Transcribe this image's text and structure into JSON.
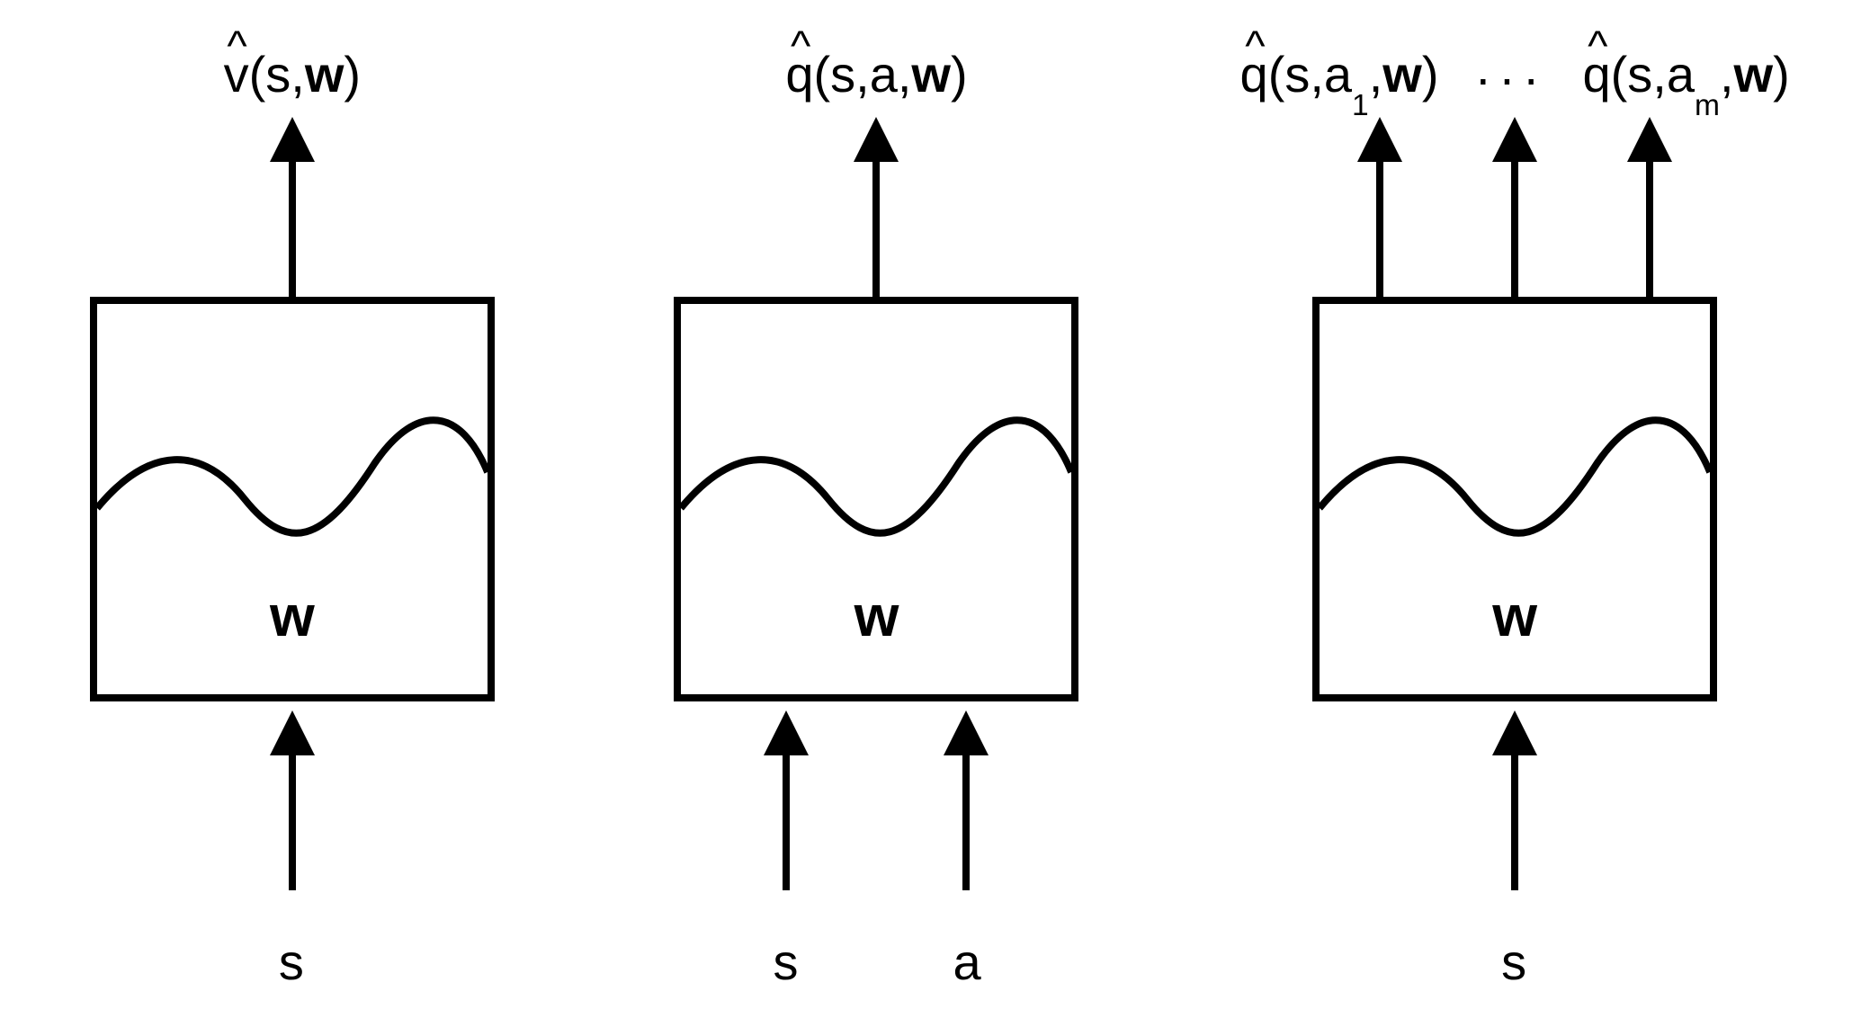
{
  "panels": [
    {
      "id": "state-value",
      "outputs": [
        {
          "fn": "v",
          "args": "(s,",
          "argsBold": "w",
          "argsClose": ")"
        }
      ],
      "inputs": [
        {
          "label": "s"
        }
      ],
      "paramLabel": "w"
    },
    {
      "id": "action-value",
      "outputs": [
        {
          "fn": "q",
          "args": "(s,a,",
          "argsBold": "w",
          "argsClose": ")"
        }
      ],
      "inputs": [
        {
          "label": "s"
        },
        {
          "label": "a"
        }
      ],
      "paramLabel": "w"
    },
    {
      "id": "action-value-multi",
      "outputs": [
        {
          "fn": "q",
          "args": "(s,a",
          "sub": "1",
          "argsMid": ",",
          "argsBold": "w",
          "argsClose": ")"
        },
        {
          "dots": "···"
        },
        {
          "fn": "q",
          "args": "(s,a",
          "sub": "m",
          "argsMid": ",",
          "argsBold": "w",
          "argsClose": ")"
        }
      ],
      "inputs": [
        {
          "label": "s"
        }
      ],
      "paramLabel": "w"
    }
  ],
  "arrowColor": "#000000",
  "strokeWidth": 8
}
